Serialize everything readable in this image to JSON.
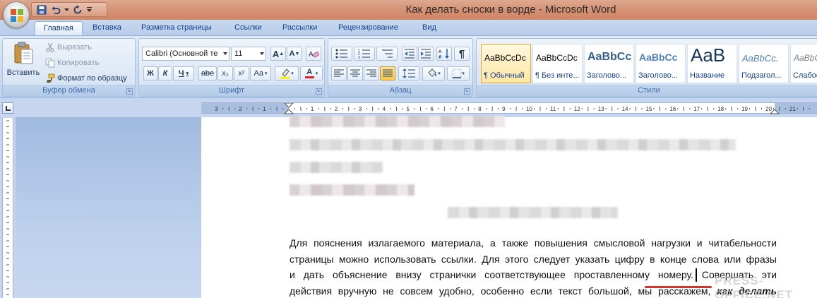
{
  "window": {
    "title": "Как делать сноски в ворде - Microsoft Word"
  },
  "tabs": [
    {
      "label": "Главная",
      "active": true
    },
    {
      "label": "Вставка"
    },
    {
      "label": "Разметка страницы"
    },
    {
      "label": "Ссылки"
    },
    {
      "label": "Рассылки"
    },
    {
      "label": "Рецензирование"
    },
    {
      "label": "Вид"
    }
  ],
  "clipboard": {
    "paste_label": "Вставить",
    "cut_label": "Вырезать",
    "copy_label": "Копировать",
    "format_painter_label": "Формат по образцу",
    "group_label": "Буфер обмена"
  },
  "font": {
    "font_name": "Calibri (Основной те",
    "font_size": "11",
    "bold": "Ж",
    "italic": "К",
    "underline": "Ч",
    "strikethrough": "abe",
    "subscript": "x₂",
    "superscript": "x²",
    "change_case": "Aa",
    "grow": "A",
    "shrink": "A",
    "font_color_letter": "A",
    "group_label": "Шрифт"
  },
  "paragraph": {
    "group_label": "Абзац",
    "pilcrow": "¶"
  },
  "styles": {
    "group_label": "Стили",
    "items": [
      {
        "sample": "AaBbCcDc",
        "name": "¶ Обычный"
      },
      {
        "sample": "AaBbCcDc",
        "name": "¶ Без инте..."
      },
      {
        "sample": "AaBbCc",
        "name": "Заголово..."
      },
      {
        "sample": "AaBbCc",
        "name": "Заголово..."
      },
      {
        "sample": "AaB",
        "name": "Название"
      },
      {
        "sample": "AaBbCc.",
        "name": "Подзагол..."
      },
      {
        "sample": "AaBbCcL",
        "name": "Слабое"
      }
    ]
  },
  "colors": {
    "accent_orange": "#e3a83e",
    "ribbon_blue": "#15428b",
    "underline_red": "#d4342b"
  },
  "document": {
    "lines": [
      "Для пояснения излагаемого материала, а также повышения смысловой нагрузки и читабельности",
      "страницы можно использовать ссылки. Для этого следует указать цифру в конце слова или фразы",
      "и дать объяснение внизу странички соответствующее проставленному номеру. Совершать эти",
      "действия вручную не совсем удобно, особенно если текст большой, мы расскажем,"
    ],
    "last_line_emphasis": "как делать"
  },
  "watermark": "PRESS-OFFICE.NET"
}
